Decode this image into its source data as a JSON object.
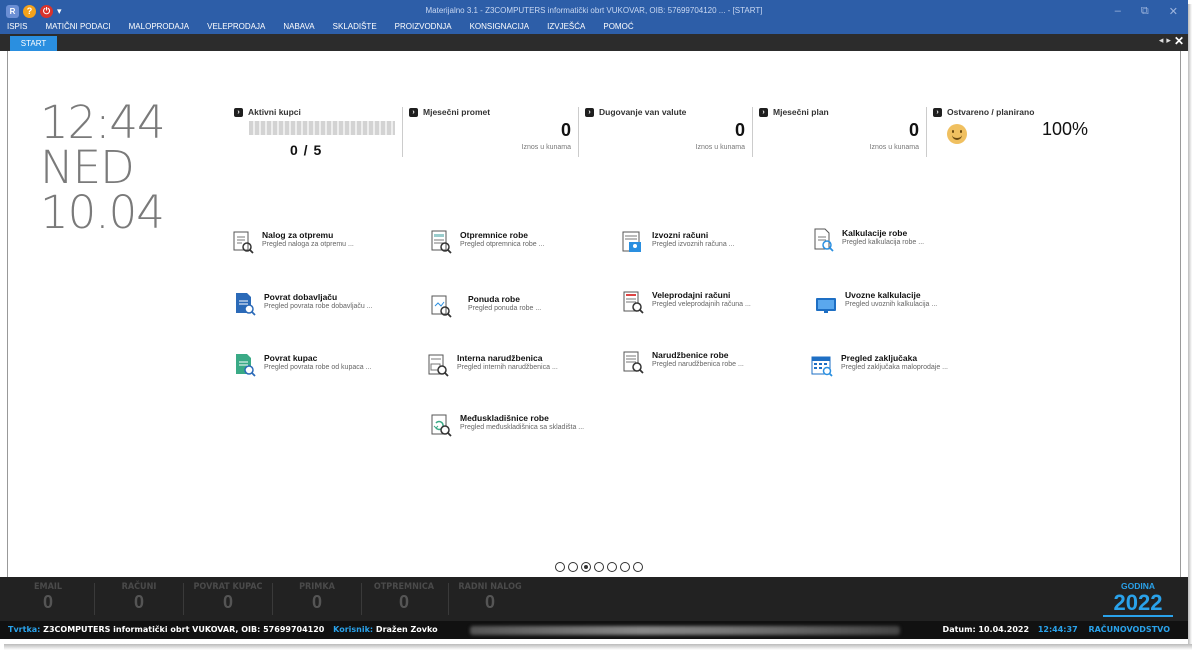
{
  "window": {
    "title": "Materijalno 3.1 - Z3COMPUTERS informatički obrt VUKOVAR, OIB: 57699704120 ... - [START]",
    "logo_text": "R"
  },
  "menu": [
    "ISPIS",
    "MATIČNI PODACI",
    "MALOPRODAJA",
    "VELEPRODAJA",
    "NABAVA",
    "SKLADIŠTE",
    "PROIZVODNJA",
    "KONSIGNACIJA",
    "IZVJEŠĆA",
    "POMOĆ"
  ],
  "tabs": {
    "active": "START"
  },
  "clock": {
    "time": "12:44",
    "day": "NED",
    "date": "10.04"
  },
  "stats": {
    "aktivni": {
      "title": "Aktivni kupci",
      "value": "0 / 5",
      "progress_fraction": 0
    },
    "promet": {
      "title": "Mjesečni promet",
      "value": "0",
      "sub": "Iznos u kunama"
    },
    "dugovanje": {
      "title": "Dugovanje van valute",
      "value": "0",
      "sub": "Iznos u kunama"
    },
    "plan": {
      "title": "Mjesečni plan",
      "value": "0",
      "sub": "Iznos u kunama"
    },
    "ostvareno": {
      "title": "Ostvareno / planirano",
      "value": "100%"
    }
  },
  "tiles": [
    {
      "title": "Nalog za otpremu",
      "desc": "Pregled naloga za otpremu ...",
      "icon": "dispatch-order-icon"
    },
    {
      "title": "Otpremnice robe",
      "desc": "Pregled otpremnica robe ...",
      "icon": "delivery-note-icon"
    },
    {
      "title": "Izvozni računi",
      "desc": "Pregled izvoznih računa ...",
      "icon": "export-invoice-icon"
    },
    {
      "title": "Kalkulacije robe",
      "desc": "Pregled kalkulacija robe ...",
      "icon": "calculation-icon"
    },
    {
      "title": "Povrat dobavljaču",
      "desc": "Pregled povrata robe dobavljaču ...",
      "icon": "supplier-return-icon"
    },
    {
      "title": "Ponuda robe",
      "desc": "Pregled ponuda robe ...",
      "icon": "offer-icon"
    },
    {
      "title": "Veleprodajni računi",
      "desc": "Pregled veleprodajnih računa ...",
      "icon": "wholesale-invoice-icon"
    },
    {
      "title": "Uvozne kalkulacije",
      "desc": "Pregled uvoznih kalkulacija ...",
      "icon": "monitor-icon"
    },
    {
      "title": "Povrat kupac",
      "desc": "Pregled povrata robe od kupaca ...",
      "icon": "customer-return-icon"
    },
    {
      "title": "Interna narudžbenica",
      "desc": "Pregled internih narudžbenica ...",
      "icon": "internal-order-icon"
    },
    {
      "title": "Narudžbenice robe",
      "desc": "Pregled narudžbenica robe ...",
      "icon": "purchase-order-icon"
    },
    {
      "title": "Pregled zaključaka",
      "desc": "Pregled zaključaka maloprodaje ...",
      "icon": "calendar-icon"
    },
    {
      "title": "Međuskladišnice robe",
      "desc": "Pregled međuskladišnica sa skladišta ...",
      "icon": "transfer-icon"
    }
  ],
  "pager": {
    "count": 7,
    "active_index": 2
  },
  "counters": [
    {
      "label": "EMAIL",
      "value": "0"
    },
    {
      "label": "RAČUNI",
      "value": "0"
    },
    {
      "label": "POVRAT KUPAC",
      "value": "0"
    },
    {
      "label": "PRIMKA",
      "value": "0"
    },
    {
      "label": "OTPREMNICA",
      "value": "0"
    },
    {
      "label": "RADNI NALOG",
      "value": "0"
    }
  ],
  "godina": {
    "label": "GODINA",
    "value": "2022"
  },
  "status": {
    "firma_key": "Tvrtka:",
    "firma_val": "Z3COMPUTERS informatički obrt VUKOVAR, OIB: 57699704120",
    "user_key": "Korisnik:",
    "user_val": "Dražen Zovko",
    "date_label": "Datum: 10.04.2022",
    "time": "12:44:37",
    "role": "RAČUNOVODSTVO"
  },
  "colors": {
    "titlebar": "#2d5ea8",
    "accent": "#2aa2ea",
    "tab_active": "#2a8fe0"
  }
}
